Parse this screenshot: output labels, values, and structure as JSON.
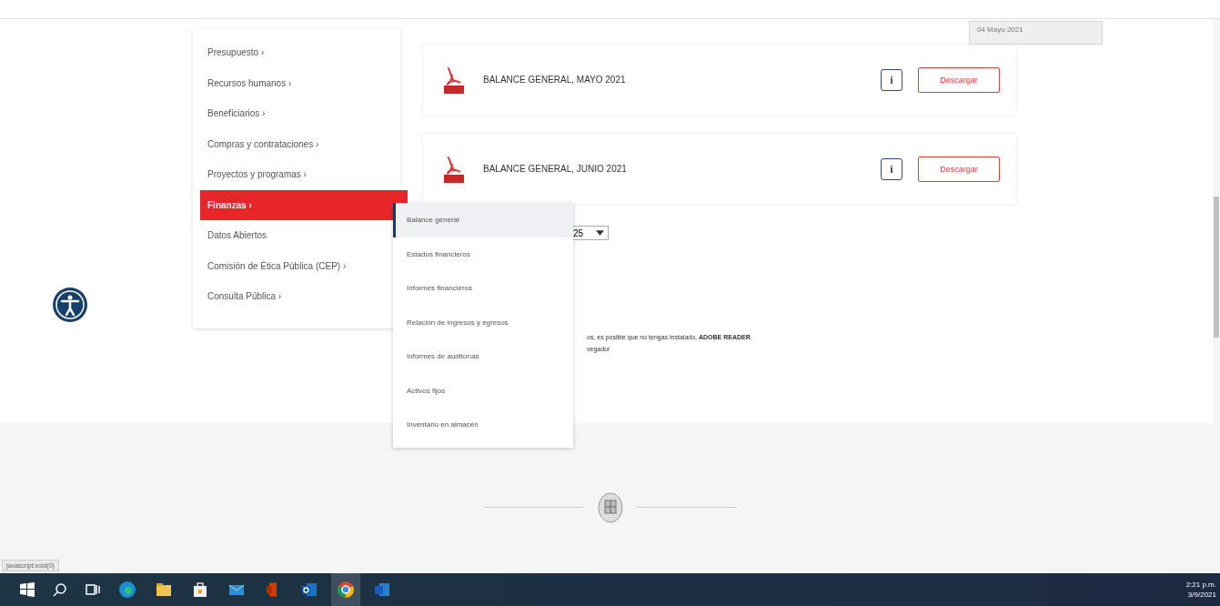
{
  "menu": {
    "items": [
      {
        "label": "Presupuesto ›",
        "selected": false
      },
      {
        "label": "Recursos humanos ›",
        "selected": false
      },
      {
        "label": "Beneficiarios ›",
        "selected": false
      },
      {
        "label": "Compras y contrataciones ›",
        "selected": false
      },
      {
        "label": "Proyectos y programas ›",
        "selected": false
      },
      {
        "label": "Finanzas ›",
        "selected": true
      },
      {
        "label": "Datos Abiertos",
        "selected": false
      },
      {
        "label": "Comisión de Ética Pública (CEP) ›",
        "selected": false
      },
      {
        "label": "Consulta Pública ›",
        "selected": false
      }
    ]
  },
  "submenu": {
    "items": [
      {
        "label": "Balance general",
        "selected": true
      },
      {
        "label": "Estados financieros",
        "selected": false
      },
      {
        "label": "Informes financieros",
        "selected": false
      },
      {
        "label": "Relación de ingresos y egresos",
        "selected": false
      },
      {
        "label": "Informes de auditorías",
        "selected": false
      },
      {
        "label": "Activos fijos",
        "selected": false
      },
      {
        "label": "Inventario en almacén",
        "selected": false
      }
    ]
  },
  "tooltip": "04 Mayo 2021",
  "documents": [
    {
      "title": "BALANCE GENERAL, MAYO 2021",
      "info": "i",
      "button": "Descargar"
    },
    {
      "title": "BALANCE GENERAL, JUNIO 2021",
      "info": "i",
      "button": "Descargar"
    }
  ],
  "page_size": "25",
  "note_lines": [
    "os, es posible que no tengas instalado, **ADOBE READER**.",
    "vegador"
  ],
  "status_url": "javascript:void(0)",
  "taskbar": {
    "time": "2:21 p.m.",
    "date": "3/9/2021"
  }
}
